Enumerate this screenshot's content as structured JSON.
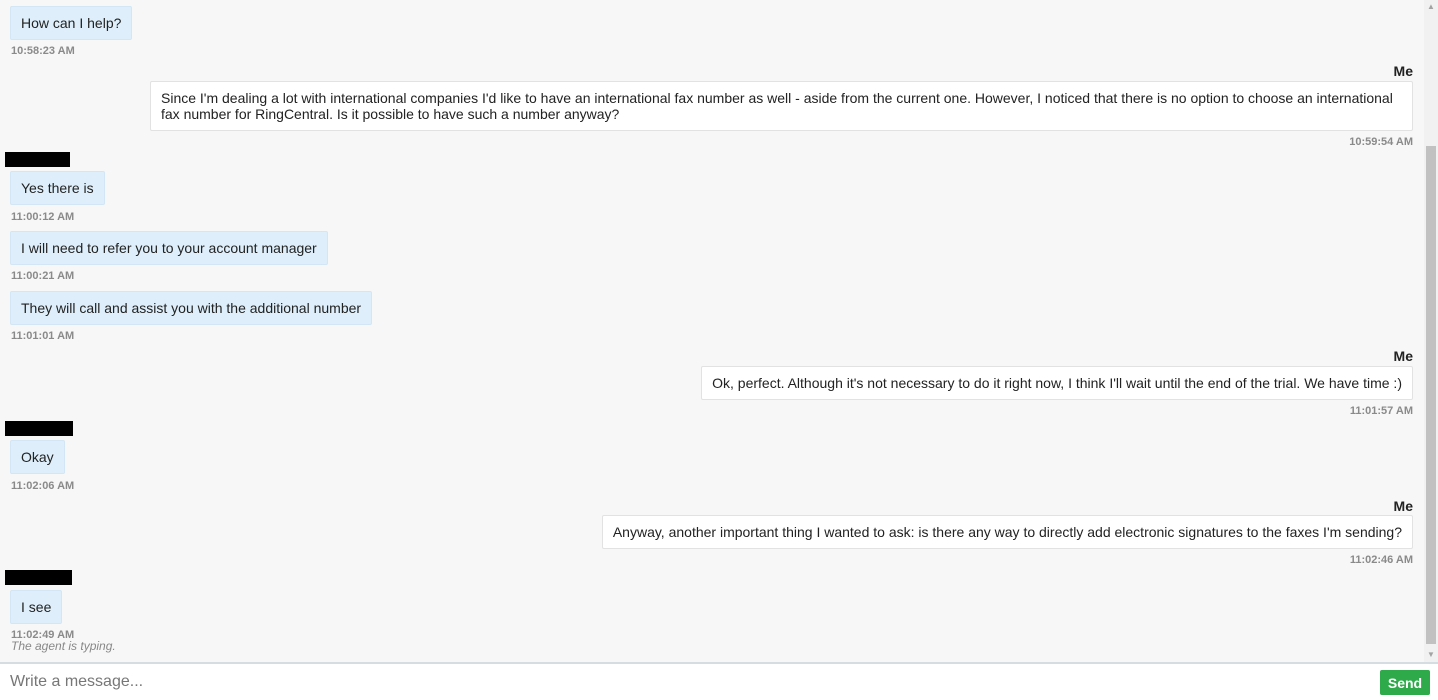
{
  "messages": [
    {
      "text": "How can I help?",
      "time": "10:58:23 AM"
    },
    {
      "sender": "Me",
      "text": "Since I'm dealing a lot with international companies I'd like to have an international fax number as well - aside from the current one. However, I noticed that there is no option to choose an international fax number for RingCentral. Is it possible to have such a number anyway?",
      "time": "10:59:54 AM"
    },
    {
      "text": "Yes there is",
      "time": "11:00:12 AM"
    },
    {
      "text": "I will need to refer you to your account manager",
      "time": "11:00:21 AM"
    },
    {
      "text": "They will call and assist you with the additional number",
      "time": "11:01:01 AM"
    },
    {
      "sender": "Me",
      "text": "Ok, perfect. Although it's not necessary to do it right now, I think I'll wait until the end of the trial. We have time :)",
      "time": "11:01:57 AM"
    },
    {
      "text": "Okay",
      "time": "11:02:06 AM"
    },
    {
      "sender": "Me",
      "text": "Anyway, another important thing I wanted to ask: is there any way to directly add electronic signatures to the faxes I'm sending?",
      "time": "11:02:46 AM"
    },
    {
      "text": "I see",
      "time": "11:02:49 AM"
    }
  ],
  "typing_indicator": "The agent is typing.",
  "composer": {
    "placeholder": "Write a message...",
    "send_label": "Send"
  },
  "colors": {
    "agent_bubble": "#deeffb",
    "user_bubble": "#ffffff",
    "send_button": "#2eaa4a"
  }
}
